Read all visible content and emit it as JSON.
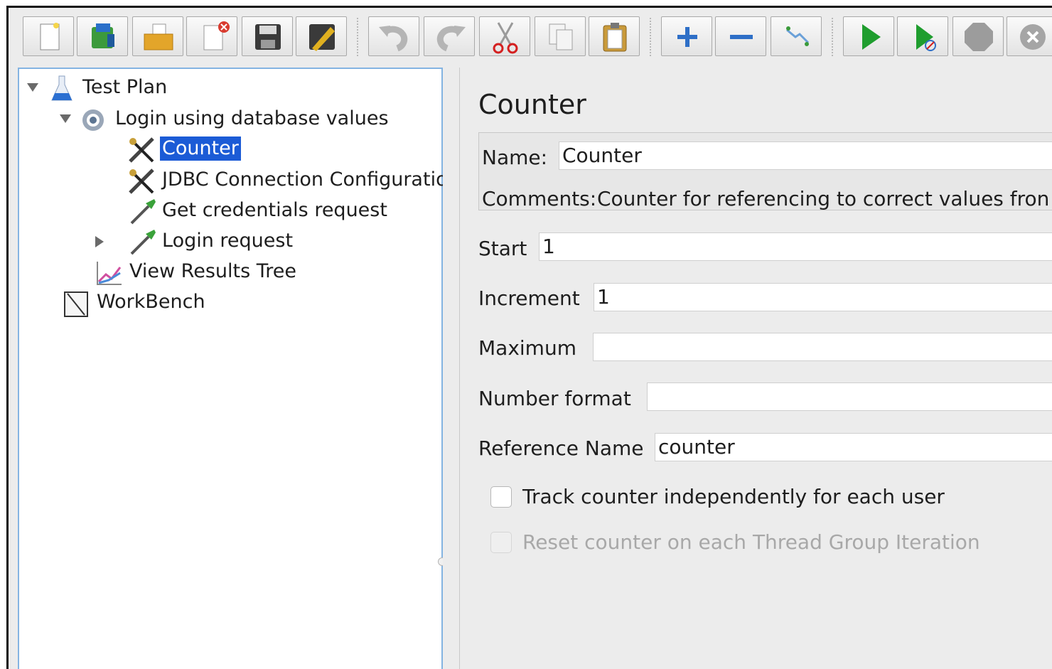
{
  "toolbar": {
    "buttons": [
      {
        "icon": "new-document-icon"
      },
      {
        "icon": "templates-icon"
      },
      {
        "icon": "open-folder-icon"
      },
      {
        "icon": "close-document-icon"
      },
      {
        "icon": "save-icon"
      },
      {
        "icon": "save-as-icon"
      },
      {
        "icon": "undo-icon"
      },
      {
        "icon": "redo-icon"
      },
      {
        "icon": "cut-icon"
      },
      {
        "icon": "copy-icon"
      },
      {
        "icon": "paste-icon"
      },
      {
        "icon": "expand-all-icon"
      },
      {
        "icon": "collapse-all-icon"
      },
      {
        "icon": "toggle-icon"
      },
      {
        "icon": "start-icon"
      },
      {
        "icon": "start-no-pauses-icon"
      },
      {
        "icon": "stop-icon"
      },
      {
        "icon": "shutdown-icon"
      }
    ]
  },
  "tree": {
    "items": [
      {
        "label": "Test Plan",
        "icon": "flask-icon",
        "expanded": true
      },
      {
        "label": "Login using database values",
        "icon": "gear-icon",
        "expanded": true
      },
      {
        "label": "Counter",
        "icon": "config-tools-icon",
        "selected": true
      },
      {
        "label": "JDBC Connection Configuration",
        "icon": "config-tools-icon"
      },
      {
        "label": "Get credentials request",
        "icon": "sampler-pipette-icon"
      },
      {
        "label": "Login request",
        "icon": "sampler-pipette-icon",
        "expanded": false
      },
      {
        "label": "View Results Tree",
        "icon": "graph-icon"
      },
      {
        "label": "WorkBench",
        "icon": "workbench-icon"
      }
    ]
  },
  "editor": {
    "title": "Counter",
    "name_label": "Name:",
    "name_value": "Counter",
    "comments_label": "Comments:",
    "comments_value": "Counter for referencing to correct values fron",
    "start_label": "Start",
    "start_value": "1",
    "increment_label": "Increment",
    "increment_value": "1",
    "maximum_label": "Maximum",
    "maximum_value": "",
    "number_format_label": "Number format",
    "number_format_value": "",
    "reference_name_label": "Reference Name",
    "reference_name_value": "counter",
    "track_label": "Track counter independently for each user",
    "track_checked": false,
    "reset_label": "Reset counter on each Thread Group Iteration",
    "reset_checked": false,
    "reset_enabled": false
  },
  "colors": {
    "selection": "#1b5bd6",
    "panel_border": "#84b4e2",
    "background": "#ececec"
  }
}
